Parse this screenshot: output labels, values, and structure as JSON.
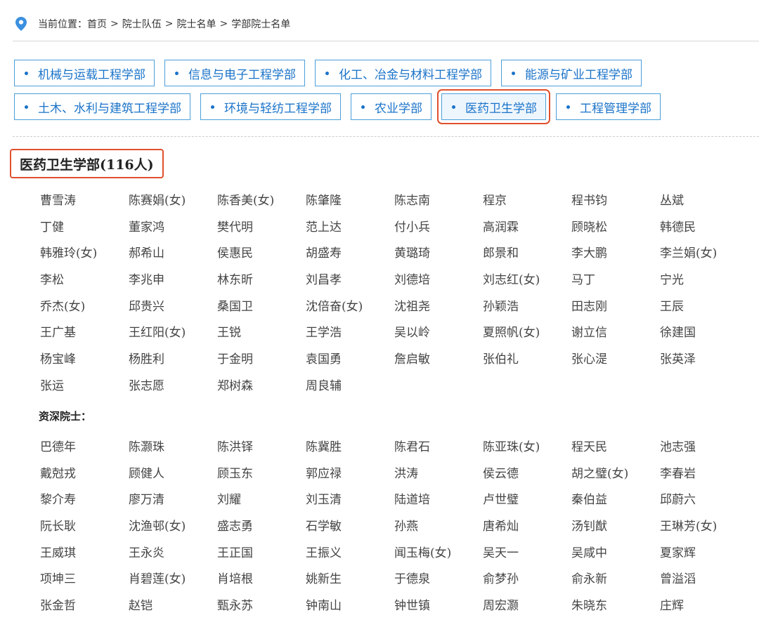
{
  "breadcrumb": {
    "prefix": "当前位置：",
    "items": [
      "首页",
      "院士队伍",
      "院士名单",
      "学部院士名单"
    ],
    "separator": ">"
  },
  "tabs": {
    "rows": [
      [
        "机械与运载工程学部",
        "信息与电子工程学部",
        "化工、冶金与材料工程学部",
        "能源与矿业工程学部"
      ],
      [
        "土木、水利与建筑工程学部",
        "环境与轻纺工程学部",
        "农业学部",
        "医药卫生学部",
        "工程管理学部"
      ]
    ],
    "active": "医药卫生学部"
  },
  "section": {
    "title": "医药卫生学部(116人)",
    "members": [
      "曹雪涛",
      "陈赛娟(女)",
      "陈香美(女)",
      "陈肇隆",
      "陈志南",
      "程京",
      "程书钧",
      "丛斌",
      "丁健",
      "董家鸿",
      "樊代明",
      "范上达",
      "付小兵",
      "高润霖",
      "顾晓松",
      "韩德民",
      "韩雅玲(女)",
      "郝希山",
      "侯惠民",
      "胡盛寿",
      "黄璐琦",
      "郎景和",
      "李大鹏",
      "李兰娟(女)",
      "李松",
      "李兆申",
      "林东昕",
      "刘昌孝",
      "刘德培",
      "刘志红(女)",
      "马丁",
      "宁光",
      "乔杰(女)",
      "邱贵兴",
      "桑国卫",
      "沈倍奋(女)",
      "沈祖尧",
      "孙颖浩",
      "田志刚",
      "王辰",
      "王广基",
      "王红阳(女)",
      "王锐",
      "王学浩",
      "吴以岭",
      "夏照帆(女)",
      "谢立信",
      "徐建国",
      "杨宝峰",
      "杨胜利",
      "于金明",
      "袁国勇",
      "詹启敏",
      "张伯礼",
      "张心湜",
      "张英泽",
      "张运",
      "张志愿",
      "郑树森",
      "周良辅"
    ],
    "senior_title": "资深院士：",
    "senior_members": [
      "巴德年",
      "陈灏珠",
      "陈洪铎",
      "陈冀胜",
      "陈君石",
      "陈亚珠(女)",
      "程天民",
      "池志强",
      "戴尅戎",
      "顾健人",
      "顾玉东",
      "郭应禄",
      "洪涛",
      "侯云德",
      "胡之璧(女)",
      "李春岩",
      "黎介寿",
      "廖万清",
      "刘耀",
      "刘玉清",
      "陆道培",
      "卢世璧",
      "秦伯益",
      "邱蔚六",
      "阮长耿",
      "沈渔邨(女)",
      "盛志勇",
      "石学敏",
      "孙燕",
      "唐希灿",
      "汤钊猷",
      "王琳芳(女)",
      "王威琪",
      "王永炎",
      "王正国",
      "王振义",
      "闻玉梅(女)",
      "吴天一",
      "吴咸中",
      "夏家辉",
      "项坤三",
      "肖碧莲(女)",
      "肖培根",
      "姚新生",
      "于德泉",
      "俞梦孙",
      "俞永新",
      "曾溢滔",
      "张金哲",
      "赵铠",
      "甄永苏",
      "钟南山",
      "钟世镇",
      "周宏灏",
      "朱晓东",
      "庄辉"
    ]
  },
  "colors": {
    "accent": "#1a73c9",
    "tab_border": "#4a9fd9",
    "highlight": "#e0502e",
    "pin": "#3b8fe0"
  },
  "icons": {
    "location": "map-pin-icon",
    "bullet": "dot-icon"
  }
}
